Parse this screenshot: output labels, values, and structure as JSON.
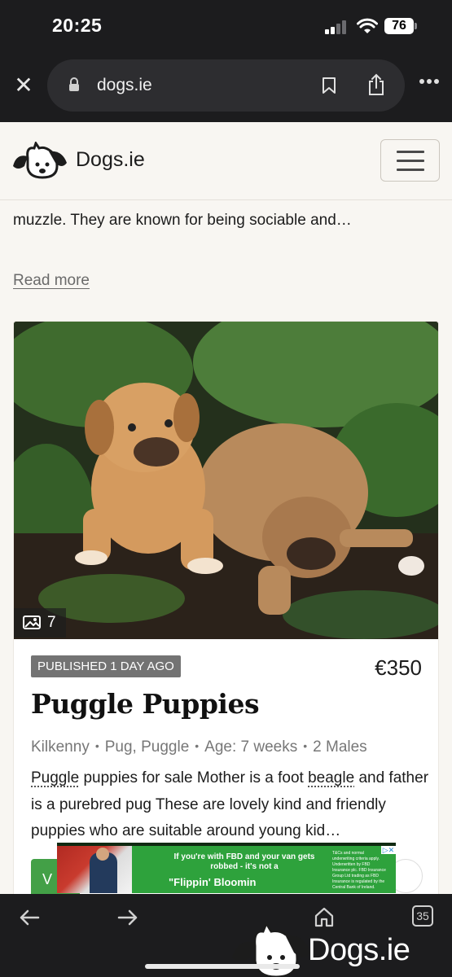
{
  "status_bar": {
    "time": "20:25",
    "battery": "76"
  },
  "browser": {
    "url": "dogs.ie",
    "tab_count": "35"
  },
  "site": {
    "name": "Dogs.ie"
  },
  "snippet": {
    "text": "muzzle. They are known for being sociable and…",
    "read_more": "Read more"
  },
  "listing": {
    "photo_count": "7",
    "published": "PUBLISHED 1 DAY AGO",
    "price": "€350",
    "title": "Puggle Puppies",
    "location": "Kilkenny",
    "breed": "Pug, Puggle",
    "age": "Age: 7 weeks",
    "sex": "2 Males",
    "desc_tag1": "Puggle",
    "desc_part1": " puppies for sale Mother is a foot ",
    "desc_tag2": "beagle",
    "desc_part2": " and father is a purebred pug These are lovely kind and friendly puppies who are suitable around young kid…",
    "contact_partial": "V"
  },
  "ad": {
    "line1": "If you're with FBD and your van gets robbed - it's not a",
    "line2": "\"Flippin' Bloomin",
    "fine_print": "T&Cs and normal underwriting criteria apply. Underwritten by FBD Insurance plc. FBD Insurance Group Ltd trading as FBD Insurance is regulated by the Central Bank of Ireland."
  },
  "watermark": {
    "text": "Dogs.ie"
  },
  "colors": {
    "accent_green": "#43a047",
    "badge_grey": "#737373"
  }
}
